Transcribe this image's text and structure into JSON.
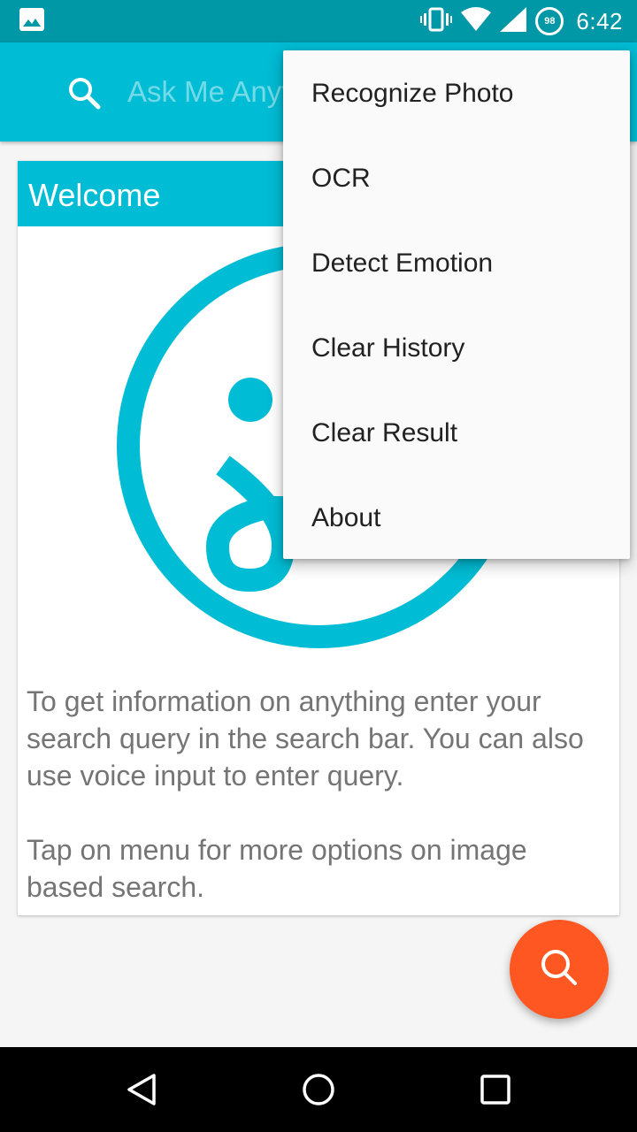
{
  "status_bar": {
    "time": "6:42",
    "battery_level": "98",
    "icons": [
      "image-notification-icon",
      "vibrate-icon",
      "wifi-icon",
      "cell-signal-icon",
      "battery-icon"
    ]
  },
  "app_bar": {
    "search_placeholder": "Ask Me Anything",
    "search_value": "",
    "search_icon": "search-icon"
  },
  "card": {
    "title": "Welcome",
    "paragraph_1": "To get information on anything enter your search query in the search bar. You can also use voice input to enter query.",
    "paragraph_2": "Tap on menu for more options on image based search."
  },
  "menu": {
    "items": [
      {
        "label": "Recognize Photo"
      },
      {
        "label": "OCR"
      },
      {
        "label": "Detect Emotion"
      },
      {
        "label": "Clear History"
      },
      {
        "label": "Clear Result"
      },
      {
        "label": "About"
      }
    ]
  },
  "fab": {
    "icon": "search-icon"
  },
  "nav_bar": {
    "icons": [
      "back-icon",
      "home-icon",
      "recents-icon"
    ]
  },
  "colors": {
    "primary": "#00bcd4",
    "primary_dark": "#0097a7",
    "accent": "#ff5722",
    "text_secondary": "#757575",
    "menu_text": "#212121"
  }
}
